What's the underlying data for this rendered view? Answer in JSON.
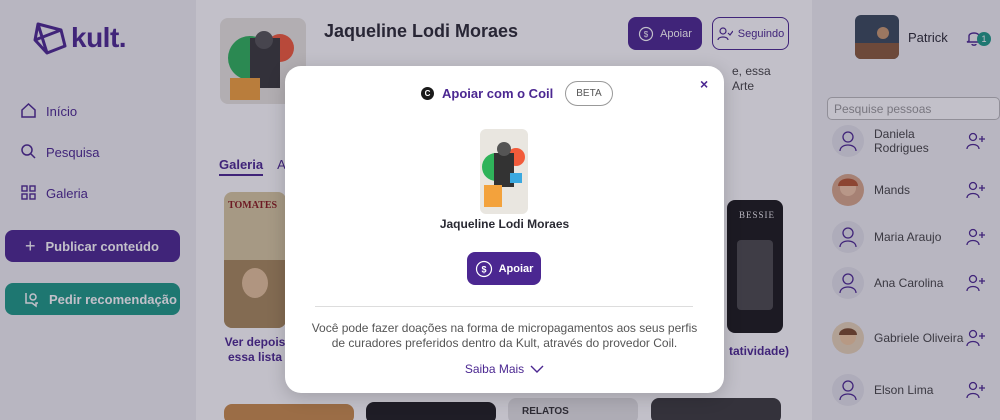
{
  "app": {
    "logo_text": "kult."
  },
  "sidebar": {
    "items": [
      {
        "label": "Início",
        "icon": "home-icon"
      },
      {
        "label": "Pesquisa",
        "icon": "search-icon"
      },
      {
        "label": "Galeria",
        "icon": "grid-icon"
      }
    ],
    "publish_label": "Publicar conteúdo",
    "request_label": "Pedir recomendação"
  },
  "profile": {
    "name": "Jaqueline Lodi Moraes",
    "apoiar_label": "Apoiar",
    "following_label": "Seguindo",
    "bio_fragment_1": "e, essa",
    "bio_fragment_2": "Arte"
  },
  "tabs": [
    {
      "label": "Galeria"
    },
    {
      "label": "At"
    }
  ],
  "gallery": {
    "card1_title": "TOMATES",
    "card1_caption_1": "Ver depois",
    "card1_caption_2": "essa lista",
    "card4_title": "BESSIE",
    "card4_caption": "tatividade)",
    "card_row2_title": "RELATOS"
  },
  "user": {
    "name": "Patrick",
    "notifications": "1"
  },
  "people_search": {
    "placeholder": "Pesquise pessoas"
  },
  "people": [
    {
      "name": "Daniela Rodrigues"
    },
    {
      "name": "Mands"
    },
    {
      "name": "Maria Araujo"
    },
    {
      "name": "Ana Carolina"
    },
    {
      "name": "Gabriele Oliveira"
    },
    {
      "name": "Elson Lima"
    }
  ],
  "modal": {
    "coil_logo": "C",
    "title": "Apoiar com o Coil",
    "beta": "BETA",
    "close": "×",
    "creator_name": "Jaqueline Lodi Moraes",
    "apoiar_label": "Apoiar",
    "description": "Você pode fazer doações na forma de micropagamentos aos seus perfis de curadores preferidos dentro da Kult, através do provedor Coil.",
    "learn_more": "Saiba Mais"
  },
  "colors": {
    "accent": "#4b2791",
    "teal": "#1d9a86",
    "background": "#f1f1f4"
  }
}
